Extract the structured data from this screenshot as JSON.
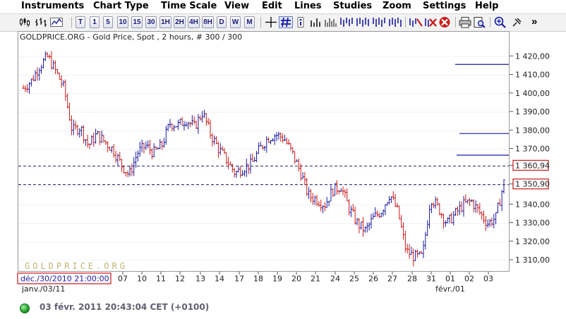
{
  "menu": {
    "items": [
      "Instruments",
      "Chart Type",
      "Time Scale",
      "View",
      "Edit",
      "Lines",
      "Studies",
      "Zoom",
      "Settings",
      "Help"
    ]
  },
  "toolbar": {
    "timeframes": [
      "T",
      "1",
      "5",
      "10",
      "15",
      "30",
      "1H",
      "2H",
      "4H",
      "8H",
      "D",
      "W",
      "M"
    ],
    "icons": [
      "candlestick-chart-icon",
      "bar-chart-icon",
      "line-chart-icon",
      "crosshair-icon",
      "grid-icon",
      "info-icon",
      "volume-icon",
      "study-1-icon",
      "study-2-icon",
      "study-3-icon",
      "study-4-icon",
      "study-5-icon",
      "trend-line-icon",
      "remove-line-icon",
      "delete-all-icon",
      "print-icon",
      "print-preview-icon",
      "zoom-in-icon",
      "pin-icon",
      "more-icon"
    ],
    "more": "»"
  },
  "chart": {
    "header": "GOLDPRICE.ORG - Gold Price, Spot , 2 hours, # 300 / 300",
    "watermark": "GOLDPRICE.ORG",
    "cursor_date": "déc./30/2010 21:00:00",
    "price_labels": [
      "1 420,00",
      "1 410,00",
      "1 400,00",
      "1 390,00",
      "1 380,00",
      "1 370,00",
      "1 360,94",
      "1 350,90",
      "1 340,00",
      "1 330,00",
      "1 320,00",
      "1 310,00"
    ],
    "x_labels": [
      "07",
      "10",
      "11",
      "12",
      "13",
      "14",
      "17",
      "18",
      "19",
      "20",
      "21",
      "24",
      "25",
      "26",
      "27",
      "28",
      "31",
      "01",
      "02",
      "03"
    ],
    "month_labels": [
      "janv./03/11",
      "févr./01"
    ],
    "colors": {
      "up": "#1a1aa0",
      "down": "#c81818",
      "hline": "#1a1aa0",
      "marker_box": "#c81818"
    }
  },
  "chart_data": {
    "type": "candlestick",
    "title": "GOLDPRICE.ORG - Gold Price, Spot , 2 hours, # 300 / 300",
    "y_ticks": [
      1310,
      1320,
      1330,
      1340,
      1350,
      1360,
      1370,
      1380,
      1390,
      1400,
      1410,
      1420
    ],
    "ylim": [
      1305,
      1428
    ],
    "x_tick_labels": [
      "07",
      "10",
      "11",
      "12",
      "13",
      "14",
      "17",
      "18",
      "19",
      "20",
      "21",
      "24",
      "25",
      "26",
      "27",
      "28",
      "31",
      "01",
      "02",
      "03"
    ],
    "marked_levels": [
      1360.94,
      1350.9
    ],
    "horizontal_lines": [
      1415.8,
      1378.5,
      1366.8,
      1360.94,
      1350.9
    ],
    "approx_close_path": [
      1403,
      1407,
      1415,
      1420,
      1412,
      1403,
      1380,
      1382,
      1372,
      1378,
      1374,
      1370,
      1362,
      1356,
      1368,
      1372,
      1368,
      1372,
      1384,
      1383,
      1386,
      1382,
      1390,
      1378,
      1370,
      1364,
      1357,
      1360,
      1362,
      1370,
      1376,
      1378,
      1376,
      1368,
      1358,
      1345,
      1343,
      1340,
      1348,
      1350,
      1338,
      1330,
      1326,
      1333,
      1337,
      1346,
      1336,
      1315,
      1312,
      1312,
      1344,
      1338,
      1330,
      1335,
      1340,
      1342,
      1336,
      1330,
      1333,
      1352
    ]
  }
}
